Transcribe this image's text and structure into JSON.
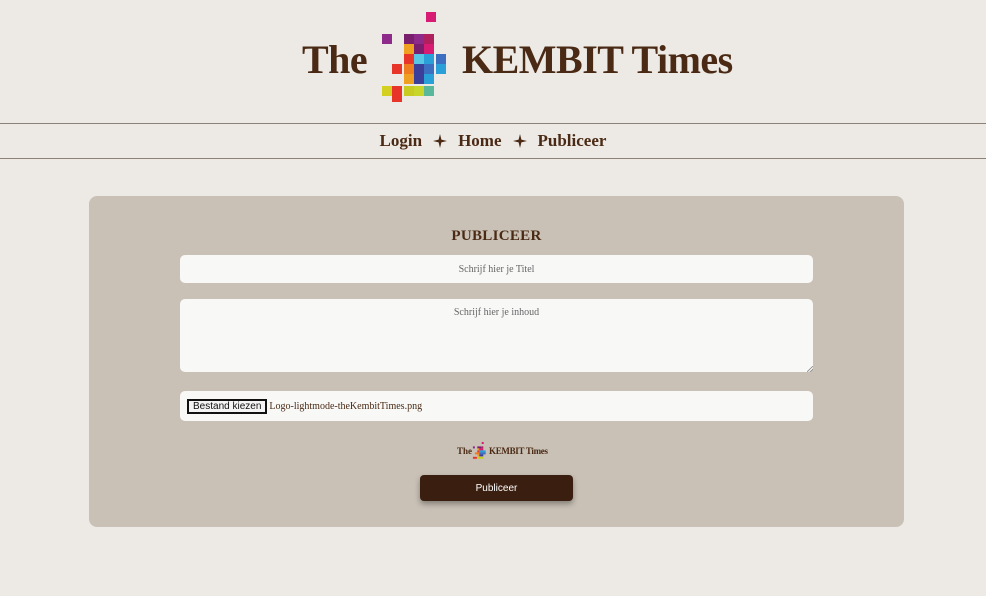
{
  "header": {
    "brand_the": "The",
    "brand_name": "KEMBIT Times",
    "brand_color": "#4a2a14"
  },
  "nav": {
    "items": [
      {
        "label": "Login"
      },
      {
        "label": "Home"
      },
      {
        "label": "Publiceer"
      }
    ],
    "separator_icon": "four-point-star-icon"
  },
  "form": {
    "heading": "PUBLICEER",
    "title_placeholder": "Schrijf hier je Titel",
    "content_placeholder": "Schrijf hier je inhoud",
    "file_button_label": "Bestand kiezen",
    "file_name": "Logo-lightmode-theKembitTimes.png",
    "preview": {
      "brand_the": "The",
      "brand_name": "KEMBIT Times"
    },
    "submit_label": "Publiceer"
  },
  "colors": {
    "page_background": "#edeae6",
    "card_background": "#c9c1b6",
    "button_background": "#3a1f10",
    "text_brown": "#4a2a14"
  }
}
